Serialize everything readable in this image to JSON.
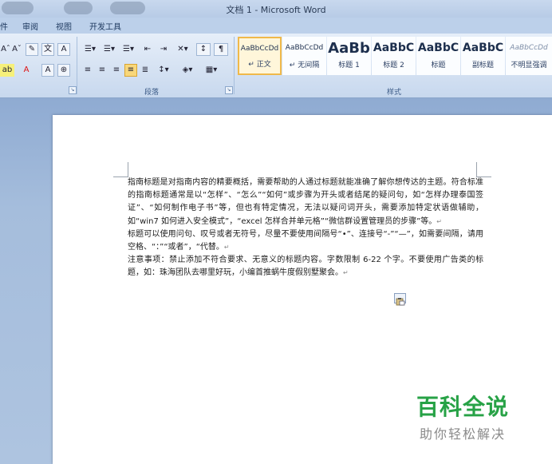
{
  "window": {
    "title": "文档 1 - Microsoft Word"
  },
  "ribbon_tabs": [
    {
      "label": "件"
    },
    {
      "label": "审阅"
    },
    {
      "label": "视图"
    },
    {
      "label": "开发工具"
    }
  ],
  "groups": {
    "paragraph": "段落",
    "styles": "样式"
  },
  "styles_gallery": [
    {
      "preview": "AaBbCcDd",
      "name": "↵ 正文",
      "selected": true
    },
    {
      "preview": "AaBbCcDd",
      "name": "↵ 无间隔",
      "selected": false
    },
    {
      "preview": "AaBb",
      "name": "标题 1",
      "selected": false
    },
    {
      "preview": "AaBbC",
      "name": "标题 2",
      "selected": false
    },
    {
      "preview": "AaBbC",
      "name": "标题",
      "selected": false
    },
    {
      "preview": "AaBbC",
      "name": "副标题",
      "selected": false
    },
    {
      "preview": "AaBbCcDd",
      "name": "不明显强调",
      "selected": false
    }
  ],
  "document": {
    "paragraphs": [
      "指南标题是对指南内容的精要概括，需要帮助的人通过标题就能准确了解你想传达的主题。符合标准的指南标题通常是以“怎样”、“怎么”“如何”或步骤为开头或者结尾的疑问句，如“怎样办理泰国签证”、“如何制作电子书”等，但也有特定情况，无法以疑问词开头，需要添加特定状语做辅助，如“win7 如何进入安全模式”，“excel 怎样合并单元格”“微信群设置管理员的步骤”等。",
      "标题可以使用问句、叹号或者无符号，尽量不要使用间隔号“•”、连接号“-”“—”，如需要间隔，请用空格、“：”“或者”，“代替。",
      "注意事项：禁止添加不符合要求、无意义的标题内容。字数限制 6-22 个字。不要使用广告类的标题，如：珠海团队去哪里好玩，小编首推蜗牛度假别墅聚会。"
    ],
    "paragraph_mark": "↵"
  },
  "watermark": {
    "main": "百科全说",
    "sub": "助你轻松解决"
  },
  "colors": {
    "accent": "#f0b94a",
    "watermark_green": "#27a246"
  }
}
